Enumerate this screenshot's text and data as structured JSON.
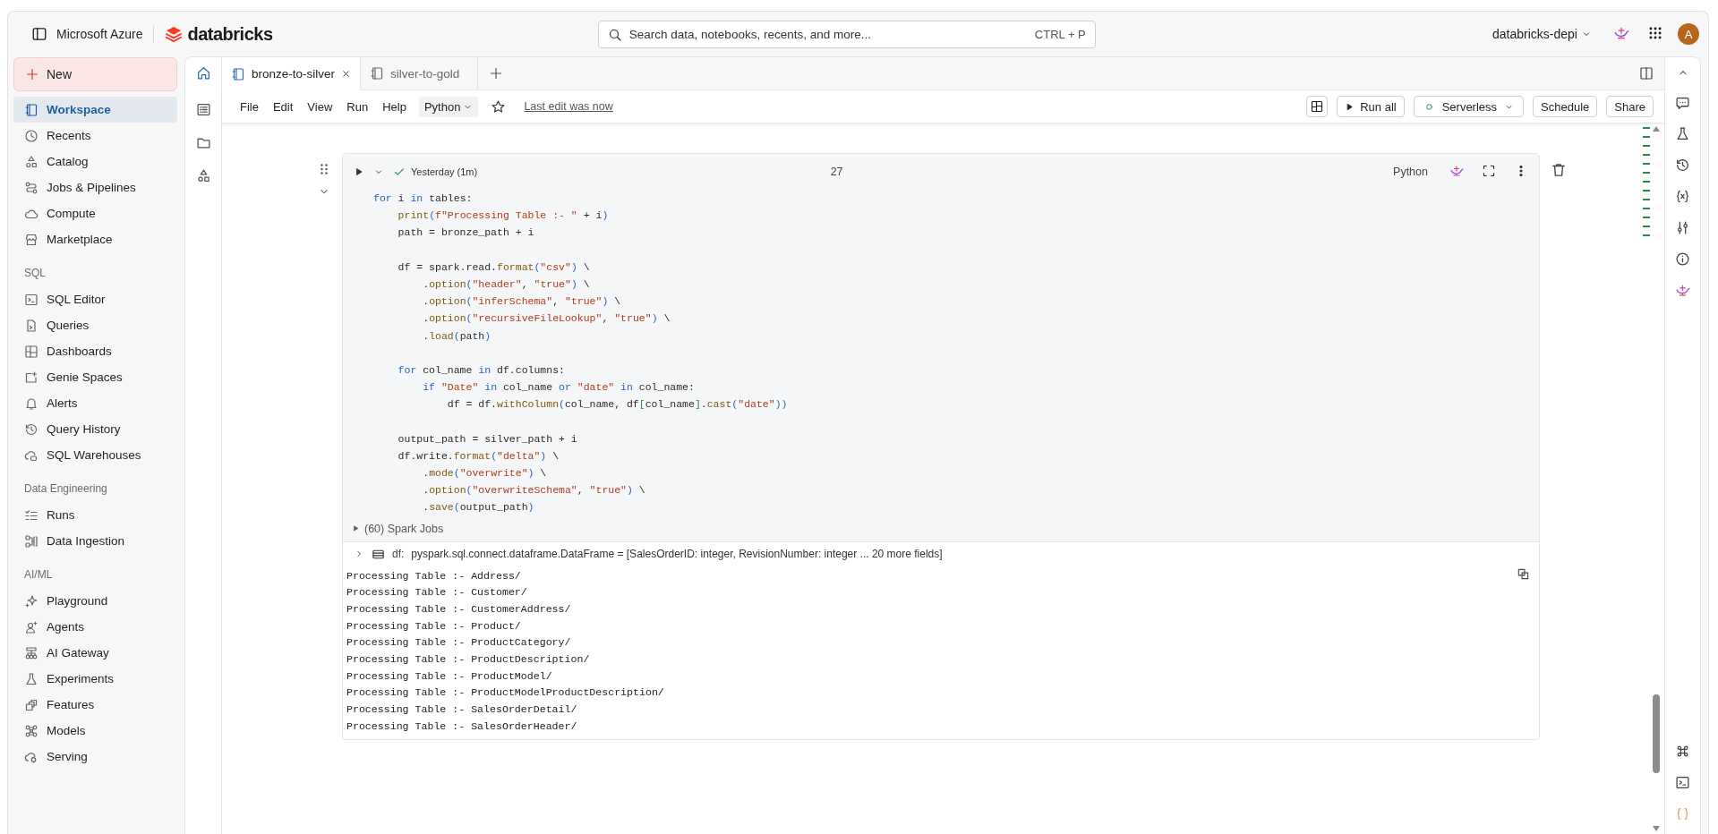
{
  "header": {
    "brand": "Microsoft Azure",
    "logo_text": "databricks",
    "search": {
      "placeholder": "Search data, notebooks, recents, and more...",
      "shortcut": "CTRL + P"
    },
    "workspace": "databricks-depi",
    "avatar": "A"
  },
  "sidebar": {
    "new_button": "New",
    "groups": [
      {
        "items": [
          {
            "label": "Workspace",
            "selected": true
          },
          {
            "label": "Recents",
            "selected": false
          },
          {
            "label": "Catalog",
            "selected": false
          },
          {
            "label": "Jobs & Pipelines",
            "selected": false
          },
          {
            "label": "Compute",
            "selected": false
          },
          {
            "label": "Marketplace",
            "selected": false
          }
        ]
      },
      {
        "heading": "SQL",
        "items": [
          {
            "label": "SQL Editor",
            "selected": false
          },
          {
            "label": "Queries",
            "selected": false
          },
          {
            "label": "Dashboards",
            "selected": false
          },
          {
            "label": "Genie Spaces",
            "selected": false
          },
          {
            "label": "Alerts",
            "selected": false
          },
          {
            "label": "Query History",
            "selected": false
          },
          {
            "label": "SQL Warehouses",
            "selected": false
          }
        ]
      },
      {
        "heading": "Data Engineering",
        "items": [
          {
            "label": "Runs",
            "selected": false
          },
          {
            "label": "Data Ingestion",
            "selected": false
          }
        ]
      },
      {
        "heading": "AI/ML",
        "items": [
          {
            "label": "Playground",
            "selected": false
          },
          {
            "label": "Agents",
            "selected": false
          },
          {
            "label": "AI Gateway",
            "selected": false
          },
          {
            "label": "Experiments",
            "selected": false
          },
          {
            "label": "Features",
            "selected": false
          },
          {
            "label": "Models",
            "selected": false
          },
          {
            "label": "Serving",
            "selected": false
          }
        ]
      }
    ]
  },
  "tabs": [
    {
      "label": "bronze-to-silver",
      "selected": true
    },
    {
      "label": "silver-to-gold",
      "selected": false
    }
  ],
  "menu": [
    "File",
    "Edit",
    "View",
    "Run",
    "Help"
  ],
  "language_menu": "Python",
  "last_edit": "Last edit was now",
  "toolbar": {
    "run_all": "Run all",
    "compute": "Serverless",
    "schedule": "Schedule",
    "share": "Share"
  },
  "cell": {
    "status": "Yesterday (1m)",
    "number": "27",
    "language": "Python",
    "code": [
      {
        "kind": "code",
        "tokens": [
          {
            "kind": "kw",
            "text": "for"
          },
          {
            "kind": "plain",
            "text": " i "
          },
          {
            "kind": "kw",
            "text": "in"
          },
          {
            "kind": "plain",
            "text": " tables:"
          }
        ]
      },
      {
        "kind": "code",
        "tokens": [
          {
            "kind": "fn",
            "text": "    print"
          },
          {
            "kind": "paren",
            "text": "("
          },
          {
            "kind": "str",
            "text": "f\"Processing Table :- \""
          },
          {
            "kind": "plain",
            "text": " + i"
          },
          {
            "kind": "paren",
            "text": ")"
          }
        ]
      },
      {
        "kind": "code",
        "tokens": [
          {
            "kind": "plain",
            "text": "    path = bronze_path + i"
          }
        ]
      },
      {
        "kind": "blank"
      },
      {
        "kind": "code",
        "tokens": [
          {
            "kind": "plain",
            "text": "    df = spark.read."
          },
          {
            "kind": "fn",
            "text": "format"
          },
          {
            "kind": "paren",
            "text": "("
          },
          {
            "kind": "str",
            "text": "\"csv\""
          },
          {
            "kind": "paren",
            "text": ")"
          },
          {
            "kind": "plain",
            "text": " \\"
          }
        ]
      },
      {
        "kind": "code",
        "tokens": [
          {
            "kind": "plain",
            "text": "        ."
          },
          {
            "kind": "fn",
            "text": "option"
          },
          {
            "kind": "paren",
            "text": "("
          },
          {
            "kind": "str",
            "text": "\"header\""
          },
          {
            "kind": "plain",
            "text": ", "
          },
          {
            "kind": "str",
            "text": "\"true\""
          },
          {
            "kind": "paren",
            "text": ")"
          },
          {
            "kind": "plain",
            "text": " \\"
          }
        ]
      },
      {
        "kind": "code",
        "tokens": [
          {
            "kind": "plain",
            "text": "        ."
          },
          {
            "kind": "fn",
            "text": "option"
          },
          {
            "kind": "paren",
            "text": "("
          },
          {
            "kind": "str",
            "text": "\"inferSchema\""
          },
          {
            "kind": "plain",
            "text": ", "
          },
          {
            "kind": "str",
            "text": "\"true\""
          },
          {
            "kind": "paren",
            "text": ")"
          },
          {
            "kind": "plain",
            "text": " \\"
          }
        ]
      },
      {
        "kind": "code",
        "tokens": [
          {
            "kind": "plain",
            "text": "        ."
          },
          {
            "kind": "fn",
            "text": "option"
          },
          {
            "kind": "paren",
            "text": "("
          },
          {
            "kind": "str",
            "text": "\"recursiveFileLookup\""
          },
          {
            "kind": "plain",
            "text": ", "
          },
          {
            "kind": "str",
            "text": "\"true\""
          },
          {
            "kind": "paren",
            "text": ")"
          },
          {
            "kind": "plain",
            "text": " \\"
          }
        ]
      },
      {
        "kind": "code",
        "tokens": [
          {
            "kind": "plain",
            "text": "        ."
          },
          {
            "kind": "fn",
            "text": "load"
          },
          {
            "kind": "paren",
            "text": "("
          },
          {
            "kind": "plain",
            "text": "path"
          },
          {
            "kind": "paren",
            "text": ")"
          }
        ]
      },
      {
        "kind": "blank"
      },
      {
        "kind": "code",
        "tokens": [
          {
            "kind": "kw",
            "text": "    for"
          },
          {
            "kind": "plain",
            "text": " col_name "
          },
          {
            "kind": "kw",
            "text": "in"
          },
          {
            "kind": "plain",
            "text": " df.columns:"
          }
        ]
      },
      {
        "kind": "code",
        "tokens": [
          {
            "kind": "kw",
            "text": "        if"
          },
          {
            "kind": "str",
            "text": " \"Date\" "
          },
          {
            "kind": "kw",
            "text": "in"
          },
          {
            "kind": "plain",
            "text": " col_name "
          },
          {
            "kind": "kw",
            "text": "or"
          },
          {
            "kind": "str",
            "text": " \"date\" "
          },
          {
            "kind": "kw",
            "text": "in"
          },
          {
            "kind": "plain",
            "text": " col_name:"
          }
        ]
      },
      {
        "kind": "code",
        "tokens": [
          {
            "kind": "plain",
            "text": "            df = df."
          },
          {
            "kind": "fn",
            "text": "withColumn"
          },
          {
            "kind": "paren",
            "text": "("
          },
          {
            "kind": "plain",
            "text": "col_name, df"
          },
          {
            "kind": "bracket",
            "text": "["
          },
          {
            "kind": "plain",
            "text": "col_name"
          },
          {
            "kind": "bracket",
            "text": "]"
          },
          {
            "kind": "plain",
            "text": "."
          },
          {
            "kind": "fn",
            "text": "cast"
          },
          {
            "kind": "paren",
            "text": "("
          },
          {
            "kind": "str",
            "text": "\"date\""
          },
          {
            "kind": "paren",
            "text": "))"
          }
        ]
      },
      {
        "kind": "blank"
      },
      {
        "kind": "code",
        "tokens": [
          {
            "kind": "plain",
            "text": "    output_path = silver_path + i"
          }
        ]
      },
      {
        "kind": "code",
        "tokens": [
          {
            "kind": "plain",
            "text": "    df.write."
          },
          {
            "kind": "fn",
            "text": "format"
          },
          {
            "kind": "paren",
            "text": "("
          },
          {
            "kind": "str",
            "text": "\"delta\""
          },
          {
            "kind": "paren",
            "text": ")"
          },
          {
            "kind": "plain",
            "text": " \\"
          }
        ]
      },
      {
        "kind": "code",
        "tokens": [
          {
            "kind": "plain",
            "text": "        ."
          },
          {
            "kind": "fn",
            "text": "mode"
          },
          {
            "kind": "paren",
            "text": "("
          },
          {
            "kind": "str",
            "text": "\"overwrite\""
          },
          {
            "kind": "paren",
            "text": ")"
          },
          {
            "kind": "plain",
            "text": " \\"
          }
        ]
      },
      {
        "kind": "code",
        "tokens": [
          {
            "kind": "plain",
            "text": "        ."
          },
          {
            "kind": "fn",
            "text": "option"
          },
          {
            "kind": "paren",
            "text": "("
          },
          {
            "kind": "str",
            "text": "\"overwriteSchema\""
          },
          {
            "kind": "plain",
            "text": ", "
          },
          {
            "kind": "str",
            "text": "\"true\""
          },
          {
            "kind": "paren",
            "text": ")"
          },
          {
            "kind": "plain",
            "text": " \\"
          }
        ]
      },
      {
        "kind": "code",
        "tokens": [
          {
            "kind": "plain",
            "text": "        ."
          },
          {
            "kind": "fn",
            "text": "save"
          },
          {
            "kind": "paren",
            "text": "("
          },
          {
            "kind": "plain",
            "text": "output_path"
          },
          {
            "kind": "paren",
            "text": ")"
          }
        ]
      }
    ],
    "spark_jobs": "(60) Spark Jobs",
    "dataframe": {
      "name": "df:",
      "schema": "pyspark.sql.connect.dataframe.DataFrame = [SalesOrderID: integer, RevisionNumber: integer ... 20 more fields]"
    },
    "output": [
      "Processing Table :- Address/",
      "Processing Table :- Customer/",
      "Processing Table :- CustomerAddress/",
      "Processing Table :- Product/",
      "Processing Table :- ProductCategory/",
      "Processing Table :- ProductDescription/",
      "Processing Table :- ProductModel/",
      "Processing Table :- ProductModelProductDescription/",
      "Processing Table :- SalesOrderDetail/",
      "Processing Table :- SalesOrderHeader/"
    ]
  }
}
